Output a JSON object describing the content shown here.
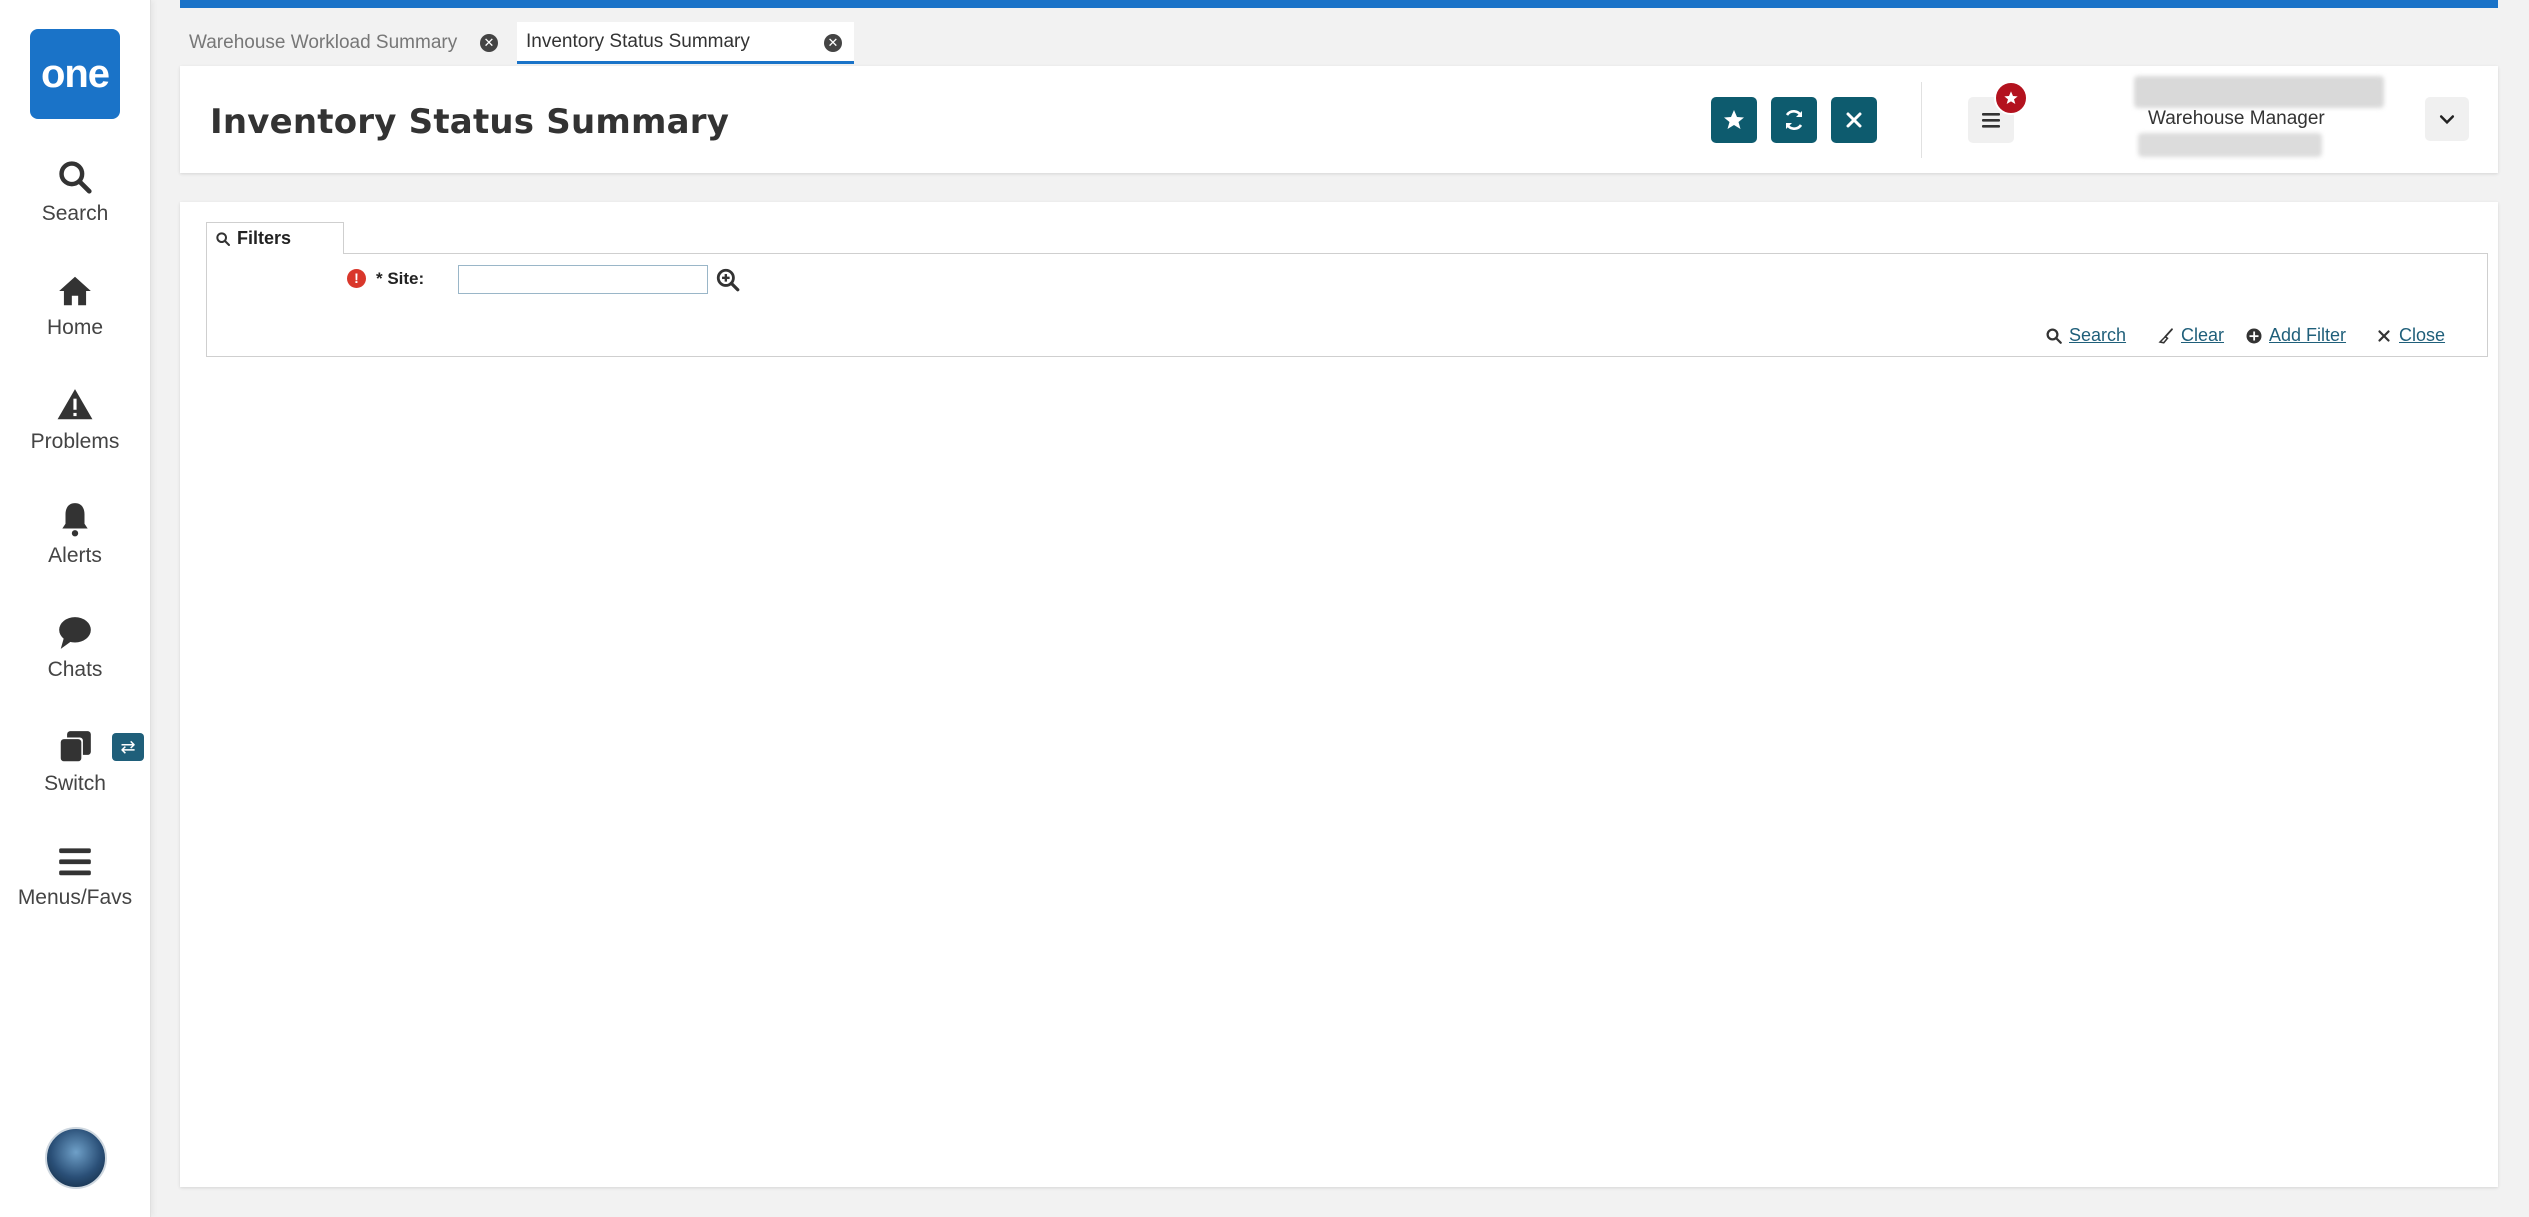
{
  "nav": {
    "logo_text": "one",
    "items": [
      {
        "label": "Search",
        "icon": "search-icon"
      },
      {
        "label": "Home",
        "icon": "home-icon"
      },
      {
        "label": "Problems",
        "icon": "warning-icon"
      },
      {
        "label": "Alerts",
        "icon": "bell-icon"
      },
      {
        "label": "Chats",
        "icon": "chat-icon"
      },
      {
        "label": "Switch",
        "icon": "switch-icon"
      },
      {
        "label": "Menus/Favs",
        "icon": "hamburger-icon"
      }
    ],
    "switch_badge": "⇄"
  },
  "tabs": [
    {
      "label": "Warehouse Workload Summary",
      "active": false
    },
    {
      "label": "Inventory Status Summary",
      "active": true
    }
  ],
  "header": {
    "title": "Inventory Status Summary",
    "user_role": "Warehouse Manager",
    "accent_color": "#0d5b6e",
    "badge_color": "#b3121e"
  },
  "filters": {
    "tab_label": "Filters",
    "site_label": "* Site:",
    "site_value": "",
    "required_icon": "!",
    "actions": {
      "search": "Search",
      "clear": "Clear",
      "add_filter": "Add Filter",
      "close": "Close"
    }
  }
}
